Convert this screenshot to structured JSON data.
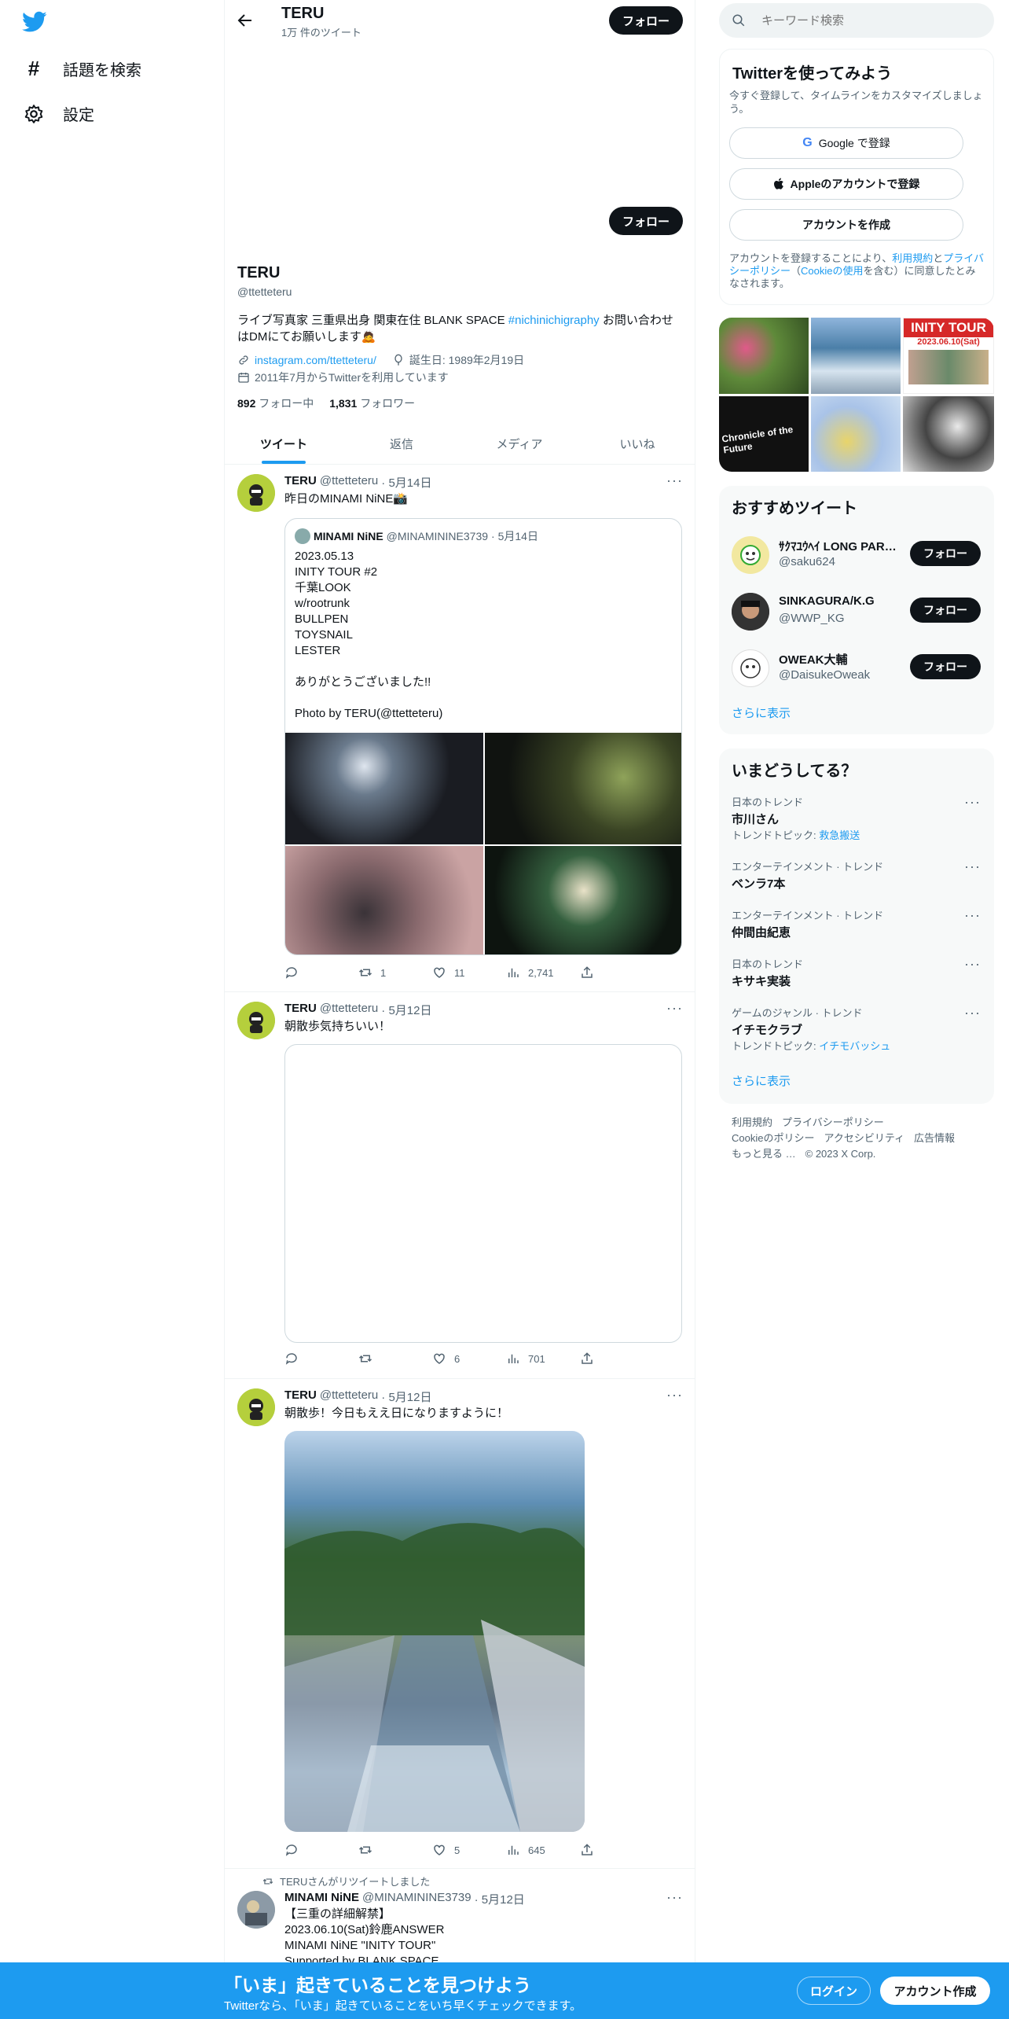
{
  "nav": {
    "explore_label": "話題を検索",
    "settings_label": "設定"
  },
  "header": {
    "name": "TERU",
    "tweet_count": "1万 件のツイート",
    "follow_label": "フォロー"
  },
  "profile": {
    "name": "TERU",
    "handle": "@ttetteteru",
    "bio_prefix": "ライブ写真家 三重県出身 関東在住 BLANK SPACE ",
    "bio_hashtag": "#nichinichigraphy",
    "bio_suffix": " お問い合わせはDMにてお願いします",
    "bio_emoji": "🙇",
    "link": "instagram.com/ttetteteru/",
    "birthday": "誕生日: 1989年2月19日",
    "joined": "2011年7月からTwitterを利用しています",
    "following_count": "892",
    "following_label": "フォロー中",
    "followers_count": "1,831",
    "followers_label": "フォロワー",
    "follow_label": "フォロー"
  },
  "tabs": [
    "ツイート",
    "返信",
    "メディア",
    "いいね"
  ],
  "tweets": [
    {
      "name": "TERU",
      "handle": "@ttetteteru",
      "date": "· 5月14日",
      "text": "昨日のMINAMI NiNE",
      "emoji": "📸",
      "quote": {
        "name": "MINAMI NiNE",
        "handle": "@MINAMININE3739",
        "date": "· 5月14日",
        "lines": [
          "2023.05.13",
          "INITY TOUR #2",
          "千葉LOOK",
          "w/rootrunk",
          "BULLPEN",
          "TOYSNAIL",
          "LESTER",
          "",
          "ありがとうございました!!",
          "",
          "Photo by TERU(@ttetteteru)"
        ]
      },
      "retweets": "1",
      "likes": "11",
      "views": "2,741"
    },
    {
      "name": "TERU",
      "handle": "@ttetteteru",
      "date": "· 5月12日",
      "text": "朝散歩気持ちいい！",
      "retweets": "",
      "likes": "6",
      "views": "701"
    },
    {
      "name": "TERU",
      "handle": "@ttetteteru",
      "date": "· 5月12日",
      "text": "朝散歩！今日もええ日になりますように！",
      "retweets": "",
      "likes": "5",
      "views": "645"
    },
    {
      "retweeted_by": "TERUさんがリツイートしました",
      "name": "MINAMI NiNE",
      "handle": "@MINAMININE3739",
      "date": "· 5月12日",
      "lines": [
        "【三重の詳細解禁】",
        "2023.06.10(Sat)鈴鹿ANSWER",
        "MINAMI NiNE \"INITY TOUR\"",
        "Supported by BLANK SPACE"
      ]
    }
  ],
  "search": {
    "placeholder": "キーワード検索"
  },
  "signup": {
    "title": "Twitterを使ってみよう",
    "subtitle": "今すぐ登録して、タイムラインをカスタマイズしましょう。",
    "google_label": "Google で登録",
    "apple_label": "Appleのアカウントで登録",
    "create_label": "アカウントを作成",
    "terms_1": "アカウントを登録することにより、",
    "terms_link1": "利用規約",
    "terms_2": "と",
    "terms_link2": "プライバシーポリシー",
    "terms_3": "（",
    "terms_link3": "Cookieの使用",
    "terms_4": "を含む）に同意したとみなされます。"
  },
  "media_grid": {
    "tile_text": "INITY TOUR",
    "tile_date": "2023.06.10(Sat)",
    "tile_chronicle": "Chronicle of the Future"
  },
  "who_to_follow": {
    "title": "おすすめツイート",
    "users": [
      {
        "name": "ｻｸﾏﾕｳﾍｲ LONG PAR…",
        "handle": "@saku624"
      },
      {
        "name": "SINKAGURA/K.G",
        "handle": "@WWP_KG"
      },
      {
        "name": "OWEAK大輔",
        "handle": "@DaisukeOweak"
      }
    ],
    "follow_label": "フォロー",
    "show_more": "さらに表示"
  },
  "trends": {
    "title": "いまどうしてる？",
    "items": [
      {
        "context": "日本のトレンド",
        "name": "市川さん",
        "topic_prefix": "トレンドトピック: ",
        "topic": "救急搬送"
      },
      {
        "context": "エンターテインメント · トレンド",
        "name": "ベンラ7本"
      },
      {
        "context": "エンターテインメント · トレンド",
        "name": "仲間由紀恵"
      },
      {
        "context": "日本のトレンド",
        "name": "キサキ実装"
      },
      {
        "context": "ゲームのジャンル · トレンド",
        "name": "イチモクラブ",
        "topic_prefix": "トレンドトピック: ",
        "topic": "イチモバッシュ"
      }
    ],
    "show_more": "さらに表示"
  },
  "footer": {
    "links": [
      "利用規約",
      "プライバシーポリシー",
      "Cookieのポリシー",
      "アクセシビリティ",
      "広告情報",
      "もっと見る …"
    ],
    "copyright": "© 2023 X Corp."
  },
  "banner": {
    "title": "「いま」起きていることを見つけよう",
    "subtitle": "Twitterなら、「いま」起きていることをいち早くチェックできます。",
    "login_label": "ログイン",
    "signup_label": "アカウント作成"
  },
  "colors": {
    "accent": "#1d9bf0",
    "text": "#0f1419",
    "muted": "#536471",
    "banner": "#1d9bf0"
  }
}
